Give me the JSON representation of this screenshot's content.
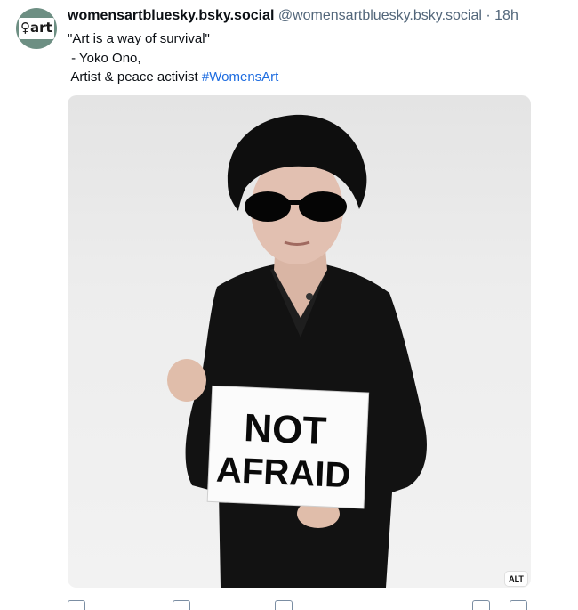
{
  "post": {
    "avatar_text": "♀art",
    "display_name": "womensartbluesky.bsky.social",
    "handle": "@womensartbluesky.bsky.social",
    "separator": "·",
    "time": "18h",
    "text_lines": [
      "\"Art is a way of survival\"",
      " - Yoko Ono,",
      " Artist & peace activist "
    ],
    "hashtag": "#WomensArt",
    "image": {
      "sign_line1": "NOT",
      "sign_line2": "AFRAID"
    },
    "alt_label": "ALT"
  },
  "actions": {
    "icons": [
      "reply-icon",
      "repost-icon",
      "like-icon",
      "more-icon",
      "bookmark-icon",
      "share-icon"
    ]
  },
  "colors": {
    "text": "#0b0f14",
    "muted": "#52667a",
    "link": "#1d6ce0",
    "avatar_bg": "#6d8f83"
  }
}
